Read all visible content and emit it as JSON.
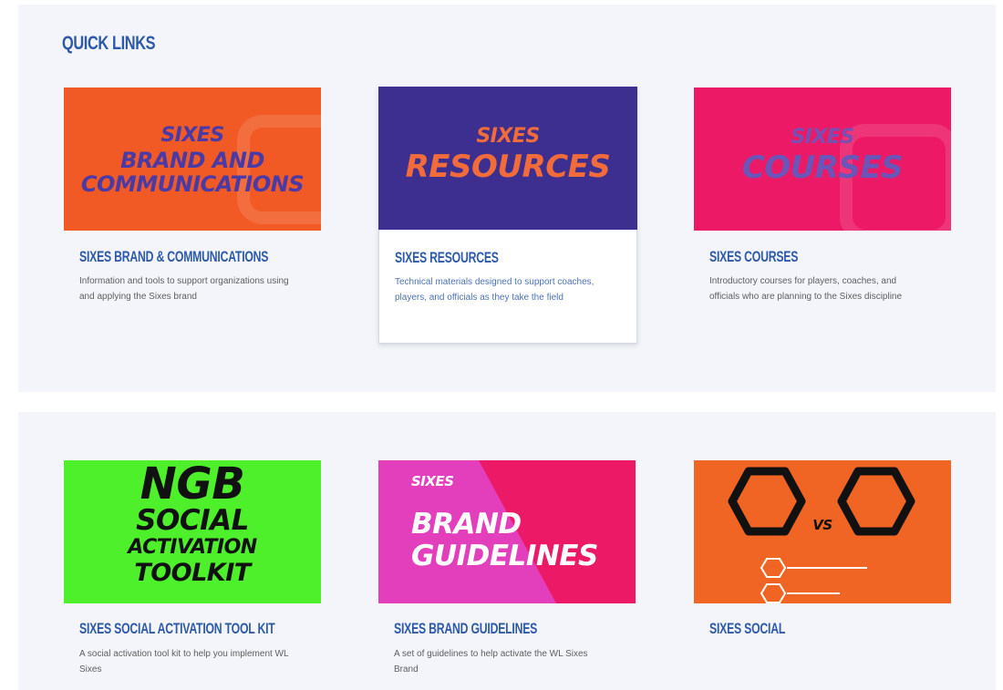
{
  "heading": "QUICK LINKS",
  "cards": [
    {
      "title": "SIXES BRAND & COMMUNICATIONS",
      "description": "Information and tools to support organizations using and applying the Sixes brand",
      "thumb": {
        "logo": "SIXES",
        "line1": "BRAND AND",
        "line2": "COMMUNICATIONS",
        "bg": "#f15a24"
      }
    },
    {
      "title": "SIXES RESOURCES",
      "description": "Technical materials designed to support coaches, players, and officials as they take the field",
      "thumb": {
        "logo": "SIXES",
        "line1": "RESOURCES",
        "bg": "#3d2f8f"
      }
    },
    {
      "title": "SIXES COURSES",
      "description": "Introductory courses for players, coaches, and officials who are planning to the Sixes discipline",
      "thumb": {
        "logo": "SIXES",
        "line1": "COURSES",
        "bg": "#ec1a66"
      }
    },
    {
      "title": "SIXES SOCIAL ACTIVATION TOOL KIT",
      "description": "A social activation tool kit to help you implement WL Sixes",
      "thumb": {
        "line1": "NGB",
        "line2": "SOCIAL",
        "line3": "ACTIVATION",
        "line4": "TOOLKIT",
        "bg": "#4ef02c"
      }
    },
    {
      "title": "SIXES BRAND GUIDELINES",
      "description": "A set of guidelines to help activate the WL Sixes Brand",
      "thumb": {
        "logo": "SIXES",
        "line1": "BRAND",
        "line2": "GUIDELINES",
        "bg": "#e33fbd"
      }
    },
    {
      "title": "SIXES SOCIAL",
      "description": "",
      "thumb": {
        "vs": "VS",
        "bg": "#f06424"
      }
    }
  ],
  "colors": {
    "accent": "#2d5aa8",
    "section_bg": "#f3f5fa"
  }
}
